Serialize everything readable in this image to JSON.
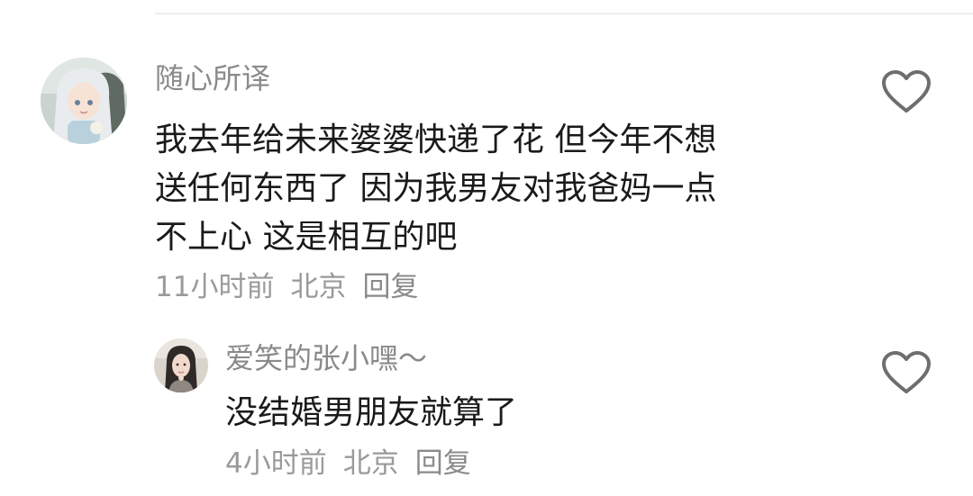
{
  "comment": {
    "username": "随心所译",
    "lines": [
      "我去年给未来婆婆快递了花 但今年不想",
      "送任何东西了 因为我男友对我爸妈一点",
      "不上心 这是相互的吧"
    ],
    "time": "11小时前",
    "location": "北京",
    "reply_label": "回复",
    "like_icon": "heart-outline-icon",
    "avatar": "anime-girl-avatar"
  },
  "reply": {
    "username": "爱笑的张小嘿～",
    "text": "没结婚男朋友就算了",
    "time": "4小时前",
    "location": "北京",
    "reply_label": "回复",
    "like_icon": "heart-outline-icon",
    "avatar": "user-photo-avatar"
  },
  "colors": {
    "username": "#8a8a8a",
    "content": "#1a1a1a",
    "meta": "#9a9a9a",
    "icon": "#6e6e6e"
  }
}
